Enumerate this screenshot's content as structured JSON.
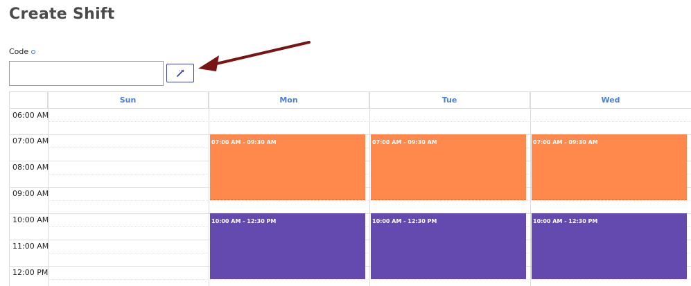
{
  "page": {
    "title": "Create Shift"
  },
  "form": {
    "code_label": "Code",
    "code_value": "",
    "generate_icon": "magic-wand-icon"
  },
  "calendar": {
    "days": [
      "Sun",
      "Mon",
      "Tue",
      "Wed"
    ],
    "times": [
      "06:00 AM",
      "07:00 AM",
      "08:00 AM",
      "09:00 AM",
      "10:00 AM",
      "11:00 AM",
      "12:00 PM"
    ],
    "events": [
      {
        "day": "Mon",
        "label": "07:00 AM - 09:30 AM",
        "color": "#ff884c"
      },
      {
        "day": "Tue",
        "label": "07:00 AM - 09:30 AM",
        "color": "#ff884c"
      },
      {
        "day": "Wed",
        "label": "07:00 AM - 09:30 AM",
        "color": "#ff884c"
      },
      {
        "day": "Mon",
        "label": "10:00 AM - 12:30 PM",
        "color": "#644aaf"
      },
      {
        "day": "Tue",
        "label": "10:00 AM - 12:30 PM",
        "color": "#644aaf"
      },
      {
        "day": "Wed",
        "label": "10:00 AM - 12:30 PM",
        "color": "#644aaf"
      }
    ]
  },
  "colors": {
    "accent": "#4a7fd4",
    "button_border": "#3c3f9e",
    "arrow": "#7a1414"
  }
}
